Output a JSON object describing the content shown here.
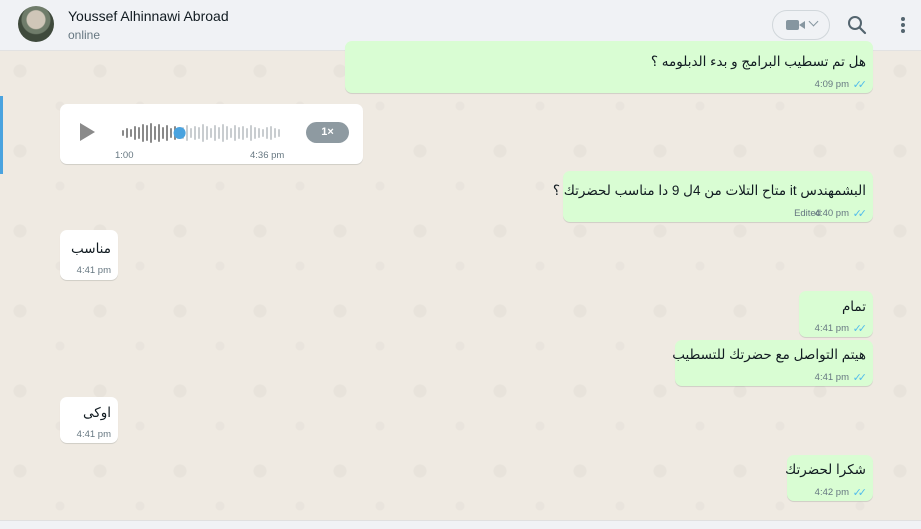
{
  "header": {
    "contact_name": "Youssef Alhinnawi Abroad",
    "status": "online"
  },
  "messages": [
    {
      "text": "هل تم تسطيب البرامج و بدء الدبلومه ؟",
      "time": "4:09 pm"
    },
    {
      "voice_elapsed": "1:00",
      "time": "4:36 pm",
      "speed": "1×",
      "progress": 0.36
    },
    {
      "text": "البشمهندس it  متاح التلات من 4ل 9 دا مناسب لحضرتك ؟",
      "edited": "Edited",
      "time": "4:40 pm"
    },
    {
      "text": "مناسب",
      "time": "4:41 pm"
    },
    {
      "text": "تمام",
      "time": "4:41 pm"
    },
    {
      "text": "هيتم التواصل مع حضرتك للتسطيب",
      "time": "4:41 pm"
    },
    {
      "text": "اوكى",
      "time": "4:41 pm"
    },
    {
      "text": "شكرا لحضرتك",
      "time": "4:42 pm"
    }
  ],
  "icons": {
    "video": "video-camera-icon",
    "search": "search-icon",
    "menu": "kebab-menu-icon",
    "play": "play-icon",
    "ticks": "double-check-icon"
  },
  "colors": {
    "outgoing_bubble": "#d9fdd3",
    "incoming_bubble": "#ffffff",
    "read_ticks": "#53bdeb",
    "wallpaper": "#efeae2"
  }
}
